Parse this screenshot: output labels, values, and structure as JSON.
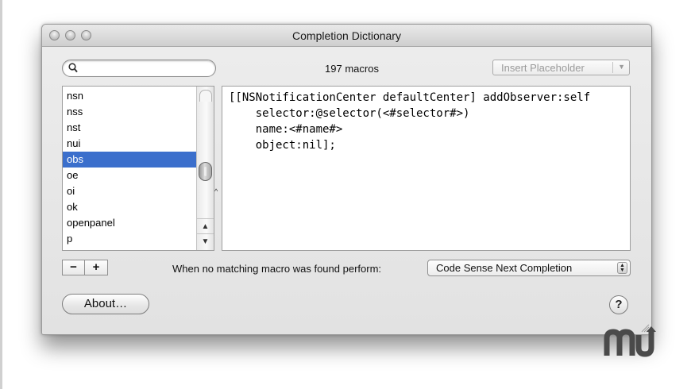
{
  "window": {
    "title": "Completion Dictionary",
    "traffic_lights": [
      "close-button",
      "minimize-button",
      "zoom-button"
    ]
  },
  "toolbar": {
    "search_placeholder": "",
    "search_value": "",
    "macro_count": "197 macros",
    "insert_placeholder_label": "Insert Placeholder"
  },
  "macro_list": {
    "items": [
      {
        "label": "nsn",
        "selected": false
      },
      {
        "label": "nss",
        "selected": false
      },
      {
        "label": "nst",
        "selected": false
      },
      {
        "label": "nui",
        "selected": false
      },
      {
        "label": "obs",
        "selected": true
      },
      {
        "label": "oe",
        "selected": false
      },
      {
        "label": "oi",
        "selected": false
      },
      {
        "label": "ok",
        "selected": false
      },
      {
        "label": "openpanel",
        "selected": false
      },
      {
        "label": "p",
        "selected": false
      }
    ]
  },
  "editor": {
    "lines": [
      "[[NSNotificationCenter defaultCenter] addObserver:self",
      "    selector:@selector(<#selector#>)",
      "    name:<#name#>",
      "    object:nil];"
    ]
  },
  "bottom": {
    "minus_label": "−",
    "plus_label": "+",
    "fallback_label": "When no matching macro was found perform:",
    "fallback_value": "Code Sense Next Completion",
    "about_label": "About…",
    "help_label": "?"
  },
  "colors": {
    "selection": "#3b6fcc",
    "window_bg": "#e6e6e6"
  },
  "icons": {
    "search": "magnifier-icon",
    "grip": "resize-grip-icon",
    "watermark": "mu-logo"
  }
}
